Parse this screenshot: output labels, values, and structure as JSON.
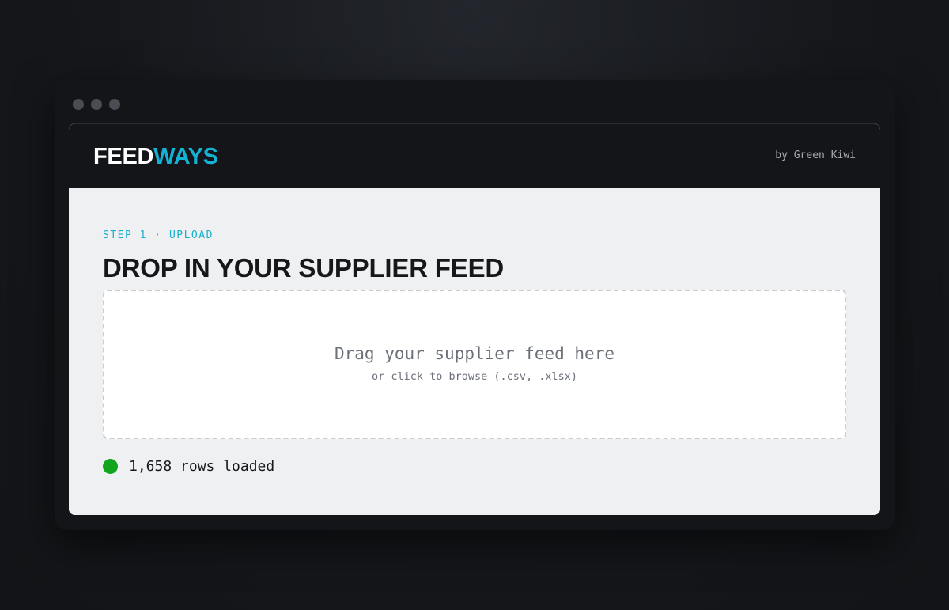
{
  "header": {
    "logo_part1": "FEED",
    "logo_part2": "WAYS",
    "byline": "by Green Kiwi"
  },
  "main": {
    "step_label": "STEP 1 · UPLOAD",
    "title": "DROP IN YOUR SUPPLIER FEED",
    "dropzone": {
      "primary": "Drag your supplier feed here",
      "secondary": "or click to browse (.csv, .xlsx)"
    },
    "status": {
      "text": "1,658 rows loaded",
      "color": "#11a51d"
    }
  },
  "colors": {
    "accent": "#14b3d6",
    "header_bg": "#131519",
    "content_bg": "#eef0f2"
  }
}
